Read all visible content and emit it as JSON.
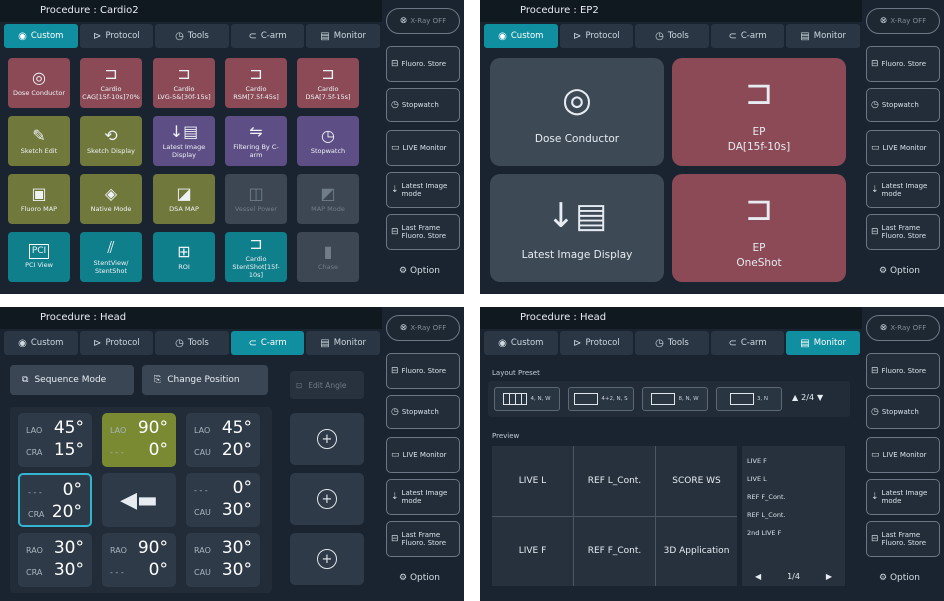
{
  "side": {
    "xray_off": "X-Ray OFF",
    "fluoro_store": "Fluoro. Store",
    "stopwatch": "Stopwatch",
    "live_monitor": "LIVE Monitor",
    "latest_image": "Latest Image",
    "mode": "mode",
    "last_frame": "Last Frame",
    "fluoro_store2": "Fluoro. Store",
    "option": "Option"
  },
  "tabs": [
    "Custom",
    "Protocol",
    "Tools",
    "C-arm",
    "Monitor"
  ],
  "panel1": {
    "title": "Procedure : Cardio2",
    "tiles": [
      {
        "l1": "Dose Conductor",
        "l2": "",
        "icon": "eye-gear-icon"
      },
      {
        "l1": "Cardio",
        "l2": "CAG[15f-10s]70%",
        "icon": "tube-icon"
      },
      {
        "l1": "Cardio",
        "l2": "LVG-5&[30f-15s]",
        "icon": "tube-icon"
      },
      {
        "l1": "Cardio",
        "l2": "RSM[7.5f-45s]",
        "icon": "tube-icon"
      },
      {
        "l1": "Cardio",
        "l2": "DSA[7.5f-15s]",
        "icon": "tube-icon"
      },
      {
        "l1": "Sketch Edit",
        "l2": "",
        "icon": "sketch-edit-icon"
      },
      {
        "l1": "Sketch Display",
        "l2": "",
        "icon": "sketch-display-icon"
      },
      {
        "l1": "Latest Image",
        "l2": "Display",
        "icon": "latest-image-icon"
      },
      {
        "l1": "Filtering By C-arm",
        "l2": "",
        "icon": "filter-icon"
      },
      {
        "l1": "Stopwatch",
        "l2": "",
        "icon": "stopwatch-icon"
      },
      {
        "l1": "Fluoro MAP",
        "l2": "",
        "icon": "fluoro-map-icon"
      },
      {
        "l1": "Native Mode",
        "l2": "",
        "icon": "native-mode-icon"
      },
      {
        "l1": "DSA MAP",
        "l2": "",
        "icon": "dsa-map-icon"
      },
      {
        "l1": "Vessel Power",
        "l2": "",
        "icon": "vessel-power-icon"
      },
      {
        "l1": "MAP Mode",
        "l2": "",
        "icon": "map-mode-icon"
      },
      {
        "l1": "PCI View",
        "l2": "",
        "icon": "pci-view-icon"
      },
      {
        "l1": "StentView/",
        "l2": "StentShot",
        "icon": "stent-icon"
      },
      {
        "l1": "ROI",
        "l2": "",
        "icon": "roi-icon"
      },
      {
        "l1": "Cardio",
        "l2": "StentShot[15f-10s]",
        "icon": "tube-icon"
      },
      {
        "l1": "Chase",
        "l2": "",
        "icon": "chase-icon"
      }
    ]
  },
  "panel2": {
    "title": "Procedure : EP2",
    "tiles": [
      {
        "l1": "Dose Conductor",
        "l2": ""
      },
      {
        "l1": "EP",
        "l2": "DA[15f-10s]"
      },
      {
        "l1": "Latest Image Display",
        "l2": ""
      },
      {
        "l1": "EP",
        "l2": "OneShot"
      }
    ]
  },
  "panel3": {
    "title": "Procedure : Head",
    "sequence_mode": "Sequence Mode",
    "change_position": "Change Position",
    "edit_angle": "Edit Angle",
    "angles": [
      {
        "a": "LAO",
        "av": "45°",
        "b": "CRA",
        "bv": "15°"
      },
      {
        "a": "LAO",
        "av": "90°",
        "b": "- - -",
        "bv": "0°"
      },
      {
        "a": "LAO",
        "av": "45°",
        "b": "CAU",
        "bv": "20°"
      },
      {
        "a": "- - -",
        "av": "0°",
        "b": "CRA",
        "bv": "20°"
      },
      {
        "a": "- - -",
        "av": "0°",
        "b": "CAU",
        "bv": "30°"
      },
      {
        "a": "RAO",
        "av": "30°",
        "b": "CRA",
        "bv": "30°"
      },
      {
        "a": "RAO",
        "av": "90°",
        "b": "- - -",
        "bv": "0°"
      },
      {
        "a": "RAO",
        "av": "30°",
        "b": "CAU",
        "bv": "30°"
      }
    ]
  },
  "panel4": {
    "title": "Procedure : Head",
    "layout_preset": "Layout Preset",
    "presets": [
      "4, N, W",
      "4+2, N, S",
      "8, N, W",
      "3, N"
    ],
    "preset_page": "2/4",
    "preview": "Preview",
    "cells": [
      "LIVE L",
      "REF L_Cont.",
      "SCORE WS",
      "LIVE F",
      "REF F_Cont.",
      "3D Application"
    ],
    "list": [
      "LIVE F",
      "LIVE L",
      "REF F_Cont.",
      "REF L_Cont.",
      "2nd LIVE F"
    ],
    "list_page": "1/4"
  }
}
